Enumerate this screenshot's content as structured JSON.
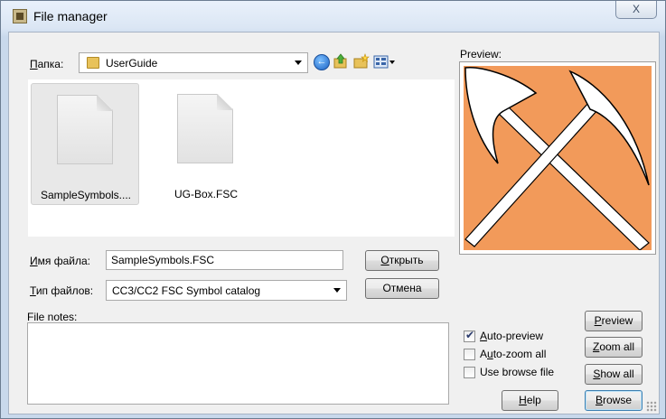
{
  "window": {
    "title": "File manager",
    "close_glyph": "X"
  },
  "folder": {
    "label": "Папка:",
    "label_accel": "П",
    "label_rest": "апка:",
    "value": "UserGuide",
    "icon": "folder-icon"
  },
  "toolbar": {
    "icons": [
      "back-icon",
      "up-folder-icon",
      "new-folder-icon",
      "view-menu-icon"
    ]
  },
  "files": [
    {
      "name": "SampleSymbols....",
      "selected": true
    },
    {
      "name": "UG-Box.FSC",
      "selected": false
    }
  ],
  "filename": {
    "label_accel": "И",
    "label_rest": "мя файла:",
    "value": "SampleSymbols.FSC"
  },
  "filetype": {
    "label_accel": "Т",
    "label_rest": "ип файлов:",
    "value": "CC3/CC2 FSC Symbol catalog"
  },
  "buttons": {
    "open_accel": "О",
    "open_rest": "ткрыть",
    "cancel": "Отмена",
    "preview_accel": "P",
    "preview_rest": "review",
    "zoom_accel": "Z",
    "zoom_rest": "oom all",
    "show_accel": "S",
    "show_rest": "how all",
    "help_accel": "H",
    "help_rest": "elp",
    "browse_accel": "B",
    "browse_rest": "rowse"
  },
  "preview": {
    "label": "Preview:",
    "bg_color": "#f29a5a",
    "icon": "crossed-pickaxes-icon"
  },
  "notes": {
    "label": "File notes:",
    "value": ""
  },
  "options": {
    "auto_preview": {
      "accel": "A",
      "rest": "uto-preview",
      "checked": true
    },
    "auto_zoom": {
      "pre": "A",
      "accel": "u",
      "rest": "to-zoom all",
      "checked": false
    },
    "use_browse": {
      "label": "Use browse file",
      "checked": false
    }
  }
}
